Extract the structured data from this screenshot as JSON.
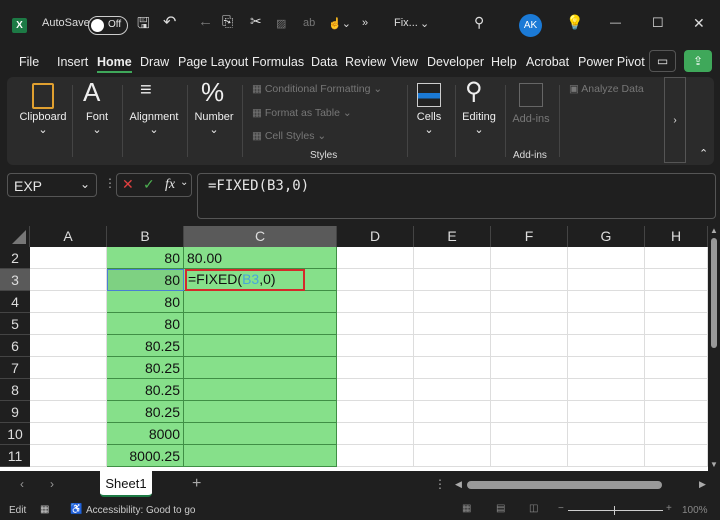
{
  "title_bar": {
    "autosave_label": "AutoSave",
    "autosave_state": "Off",
    "file_name": "Fix...",
    "user_initials": "AK",
    "more": "»"
  },
  "tabs": [
    "File",
    "Insert",
    "Home",
    "Draw",
    "Page Layout",
    "Formulas",
    "Data",
    "Review",
    "View",
    "Developer",
    "Help",
    "Acrobat",
    "Power Pivot"
  ],
  "active_tab": "Home",
  "ribbon": {
    "clipboard": "Clipboard",
    "font": "Font",
    "alignment": "Alignment",
    "number": "Number",
    "conditional_formatting": "Conditional Formatting",
    "format_as_table": "Format as Table",
    "cell_styles": "Cell Styles",
    "styles": "Styles",
    "cells": "Cells",
    "editing": "Editing",
    "addins_btn": "Add-ins",
    "addins_group": "Add-ins",
    "analyze_data": "Analyze Data"
  },
  "formula_bar": {
    "name_box": "EXP",
    "formula": "=FIXED(B3,0)",
    "fx": "fx"
  },
  "columns": [
    "A",
    "B",
    "C",
    "D",
    "E",
    "F",
    "G",
    "H"
  ],
  "selected_column": "C",
  "rows": [
    {
      "n": "2",
      "b": "80",
      "c": "80.00"
    },
    {
      "n": "3",
      "b": "80",
      "c_prefix": "=FIXED(",
      "c_ref": "B3",
      "c_suffix": ",0)"
    },
    {
      "n": "4",
      "b": "80",
      "c": ""
    },
    {
      "n": "5",
      "b": "80",
      "c": ""
    },
    {
      "n": "6",
      "b": "80.25",
      "c": ""
    },
    {
      "n": "7",
      "b": "80.25",
      "c": ""
    },
    {
      "n": "8",
      "b": "80.25",
      "c": ""
    },
    {
      "n": "9",
      "b": "80.25",
      "c": ""
    },
    {
      "n": "10",
      "b": "8000",
      "c": ""
    },
    {
      "n": "11",
      "b": "8000.25",
      "c": ""
    }
  ],
  "sheet_tab": "Sheet1",
  "status": {
    "mode": "Edit",
    "accessibility": "Accessibility: Good to go",
    "zoom": "100%"
  },
  "colors": {
    "fill": "#86e08a",
    "highlight_border": "#d42a2a",
    "ref_color": "#4aa6d8",
    "accent": "#3fa85a"
  }
}
